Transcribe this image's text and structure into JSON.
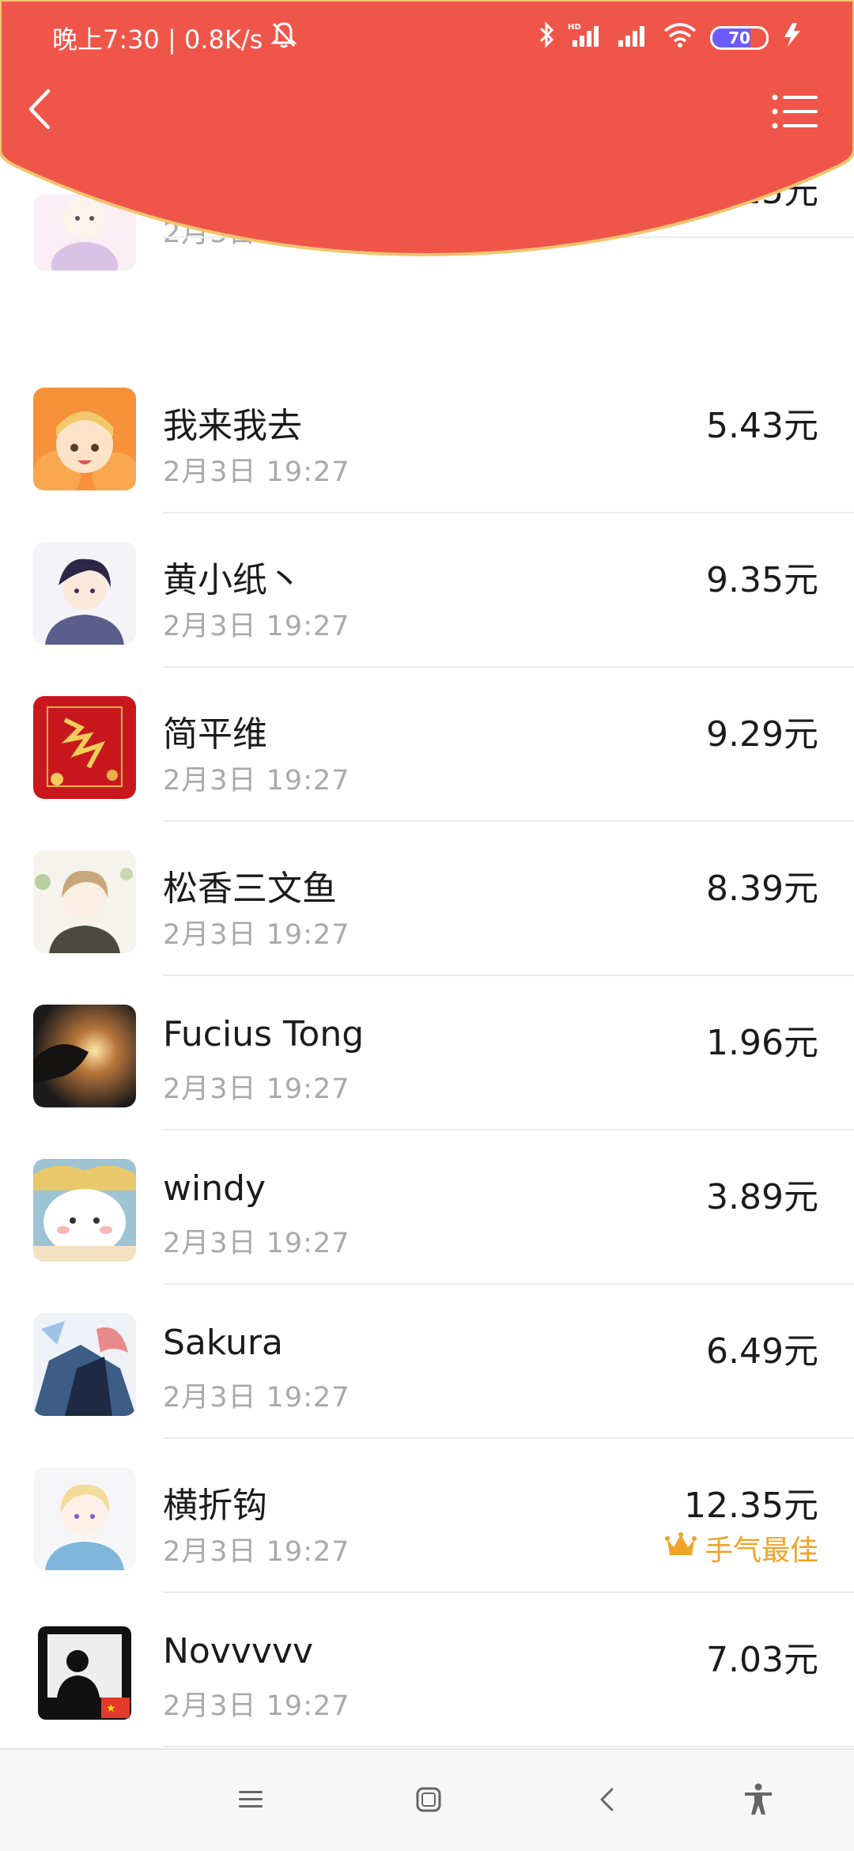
{
  "status_bar": {
    "time_text": "晚上7:30 | 0.8K/s",
    "battery_level": "70",
    "battery_fraction": 0.7
  },
  "header": {
    "color": "#f0554a",
    "back_icon": "chevron-left-icon",
    "menu_icon": "list-menu-icon"
  },
  "records": [
    {
      "name": "🍉",
      "time": "2月3日  19:29",
      "amount": "5.25元"
    },
    {
      "name": "我来我去",
      "time": "2月3日  19:27",
      "amount": "5.43元"
    },
    {
      "name": "黄小纸丶",
      "time": "2月3日  19:27",
      "amount": "9.35元"
    },
    {
      "name": "简平维",
      "time": "2月3日  19:27",
      "amount": "9.29元"
    },
    {
      "name": "松香三文鱼",
      "time": "2月3日  19:27",
      "amount": "8.39元"
    },
    {
      "name": "Fucius Tong",
      "time": "2月3日  19:27",
      "amount": "1.96元"
    },
    {
      "name": "windy",
      "time": "2月3日  19:27",
      "amount": "3.89元"
    },
    {
      "name": "Sakura",
      "time": "2月3日  19:27",
      "amount": "6.49元"
    },
    {
      "name": "横折钩",
      "time": "2月3日  19:27",
      "amount": "12.35元",
      "best_label": "手气最佳"
    },
    {
      "name": "Novvvvv",
      "time": "2月3日  19:27",
      "amount": "7.03元"
    }
  ],
  "nav_bar": {
    "icons": [
      "menu-icon",
      "home-icon",
      "back-icon",
      "accessibility-icon"
    ]
  },
  "colors": {
    "header_red": "#f0554a",
    "best_gold": "#f0a326",
    "time_gray": "#a9a9a9"
  }
}
